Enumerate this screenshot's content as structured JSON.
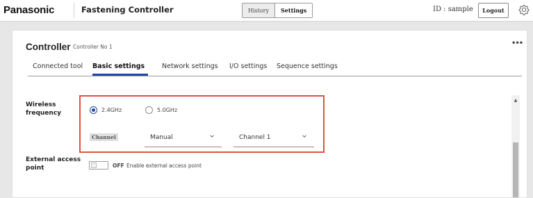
{
  "header": {
    "brand": "Panasonic",
    "app_title": "Fastening Controller",
    "nav": {
      "history": "History",
      "settings": "Settings",
      "active": "Settings"
    },
    "user_id": "ID : sample",
    "logout": "Logout"
  },
  "panel": {
    "title": "Controller",
    "subtitle": "Controller No 1",
    "more_icon": "more-horizontal-icon",
    "tabs": [
      {
        "label": "Connected tool",
        "active": false
      },
      {
        "label": "Basic settings",
        "active": true
      },
      {
        "label": "Network settings",
        "active": false
      },
      {
        "label": "I/O settings",
        "active": false
      },
      {
        "label": "Sequence settings",
        "active": false
      }
    ]
  },
  "wireless": {
    "label_line1": "Wireless",
    "label_line2": "frequency",
    "options": [
      {
        "label": "2.4GHz",
        "checked": true
      },
      {
        "label": "5.0GHz",
        "checked": false
      }
    ],
    "channel_chip": "Channel",
    "mode_select": "Manual",
    "channel_select": "Channel 1"
  },
  "external_access": {
    "label_line1": "External access",
    "label_line2": "point",
    "state": "OFF",
    "description": "Enable external access point"
  },
  "colors": {
    "accent": "#1f4aa0",
    "highlight_border": "#e0523a",
    "background": "#e7e7e7"
  }
}
